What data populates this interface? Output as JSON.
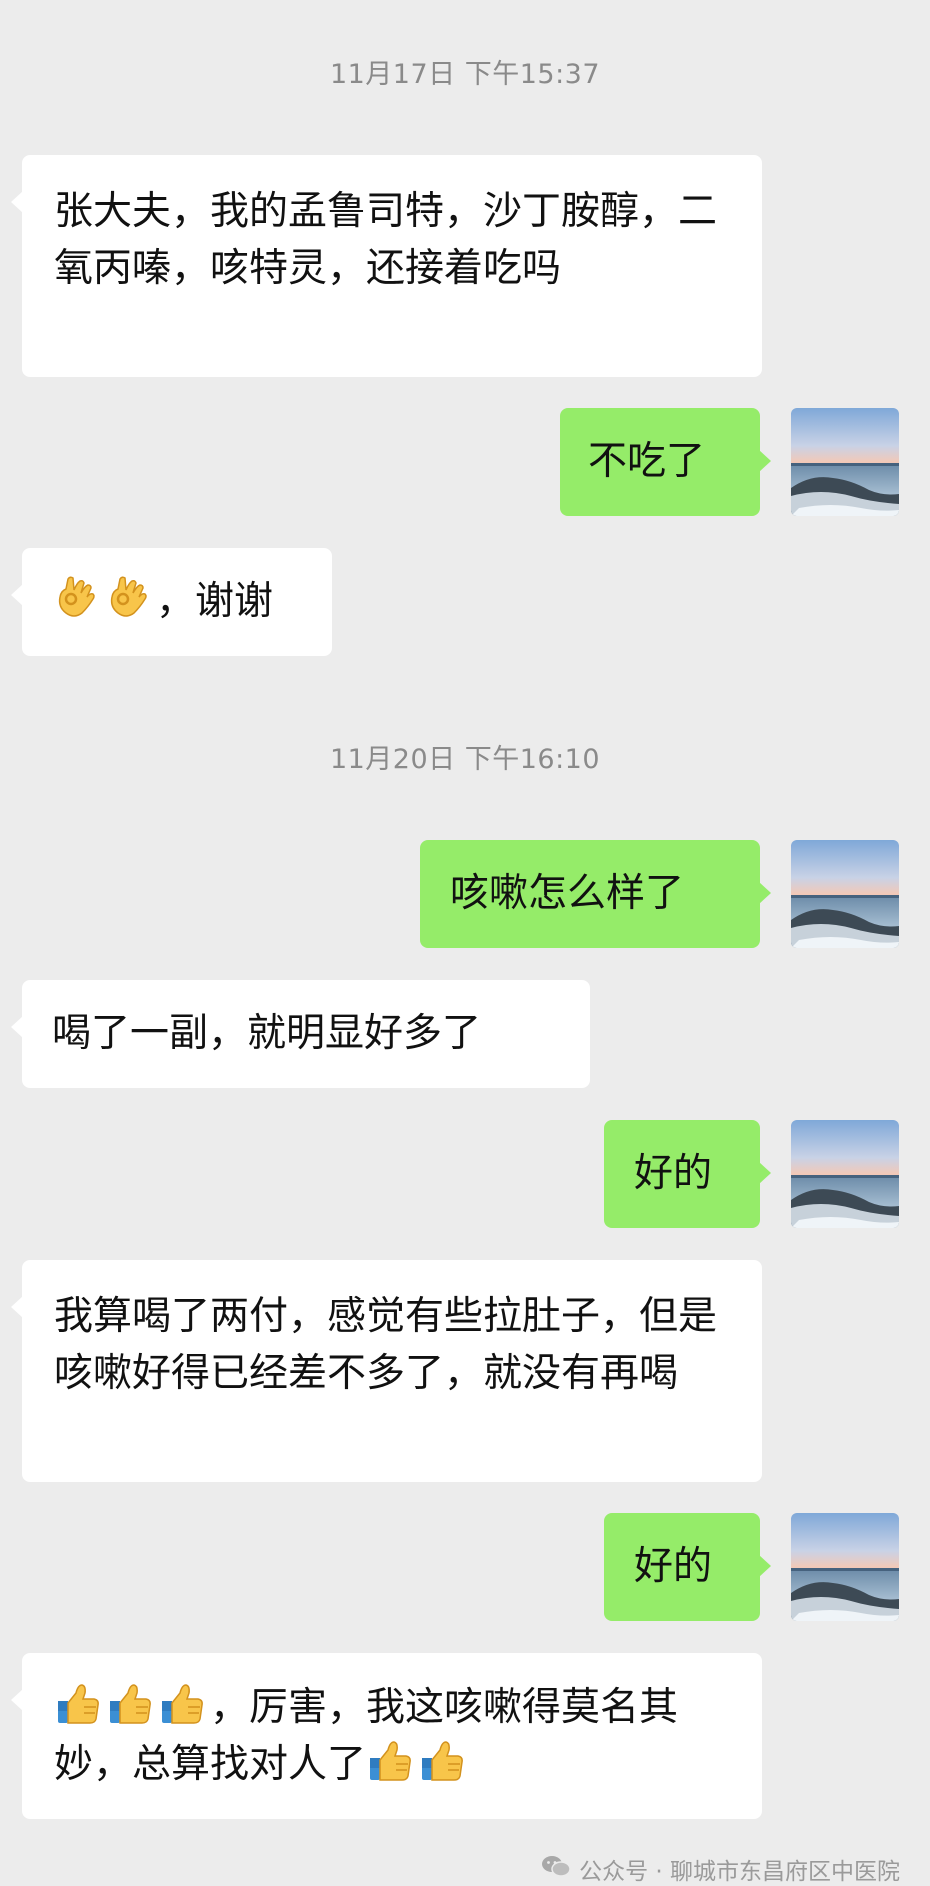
{
  "timestamps": {
    "first": "11月17日  下午15:37",
    "second": "11月20日  下午16:10"
  },
  "messages": [
    {
      "side": "left",
      "text": "张大夫，我的孟鲁司特，沙丁胺醇，二氧丙嗪，咳特灵，还接着吃吗"
    },
    {
      "side": "right",
      "text": "不吃了"
    },
    {
      "side": "left",
      "emoji": [
        "ok-hand-icon",
        "ok-hand-icon"
      ],
      "text": "，谢谢"
    },
    {
      "side": "right",
      "text": "咳嗽怎么样了"
    },
    {
      "side": "left",
      "text": "喝了一副，就明显好多了"
    },
    {
      "side": "right",
      "text": "好的"
    },
    {
      "side": "left",
      "text": "我算喝了两付，感觉有些拉肚子，但是咳嗽好得已经差不多了，就没有再喝"
    },
    {
      "side": "right",
      "text": "好的"
    },
    {
      "side": "left",
      "emoji": [
        "thumbs-up-icon",
        "thumbs-up-icon",
        "thumbs-up-icon",
        "thumbs-up-icon",
        "thumbs-up-icon"
      ],
      "text_a": "，厉害，我这咳嗽得莫名其妙，总算找对人了"
    }
  ],
  "watermark": {
    "text": "公众号 · 聊城市东昌府区中医院",
    "icon": "wechat-icon"
  },
  "colors": {
    "background": "#ececec",
    "left_bubble": "#ffffff",
    "right_bubble": "#95ec69",
    "timestamp": "#8a8a8a"
  }
}
